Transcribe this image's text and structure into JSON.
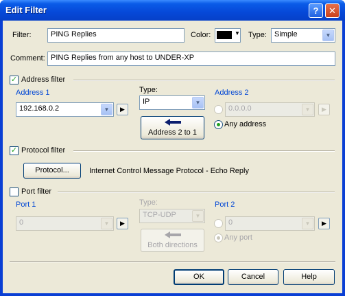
{
  "window": {
    "title": "Edit Filter",
    "help_glyph": "?",
    "close_glyph": "✕"
  },
  "top": {
    "filter_label": "Filter:",
    "filter_value": "PING Replies",
    "color_label": "Color:",
    "color_value": "#000000",
    "type_label": "Type:",
    "type_value": "Simple",
    "comment_label": "Comment:",
    "comment_value": "PING Replies from any host to UNDER-XP"
  },
  "address_filter": {
    "checked": true,
    "check_glyph": "✓",
    "label": "Address filter",
    "address1_label": "Address 1",
    "address1_value": "192.168.0.2",
    "type_label": "Type:",
    "type_value": "IP",
    "swap_label": "Address 2 to 1",
    "address2_label": "Address 2",
    "address2_value": "0.0.0.0",
    "any_address_label": "Any address"
  },
  "protocol_filter": {
    "checked": true,
    "check_glyph": "✓",
    "label": "Protocol filter",
    "button_label": "Protocol...",
    "description": "Internet Control Message Protocol - Echo Reply"
  },
  "port_filter": {
    "checked": false,
    "label": "Port filter",
    "port1_label": "Port 1",
    "port1_value": "0",
    "type_label": "Type:",
    "type_value": "TCP-UDP",
    "both_label": "Both directions",
    "port2_label": "Port 2",
    "port2_value": "0",
    "any_port_label": "Any port"
  },
  "footer": {
    "ok_label": "OK",
    "cancel_label": "Cancel",
    "help_label": "Help"
  },
  "glyphs": {
    "dropdown": "▼",
    "play": "▶"
  }
}
